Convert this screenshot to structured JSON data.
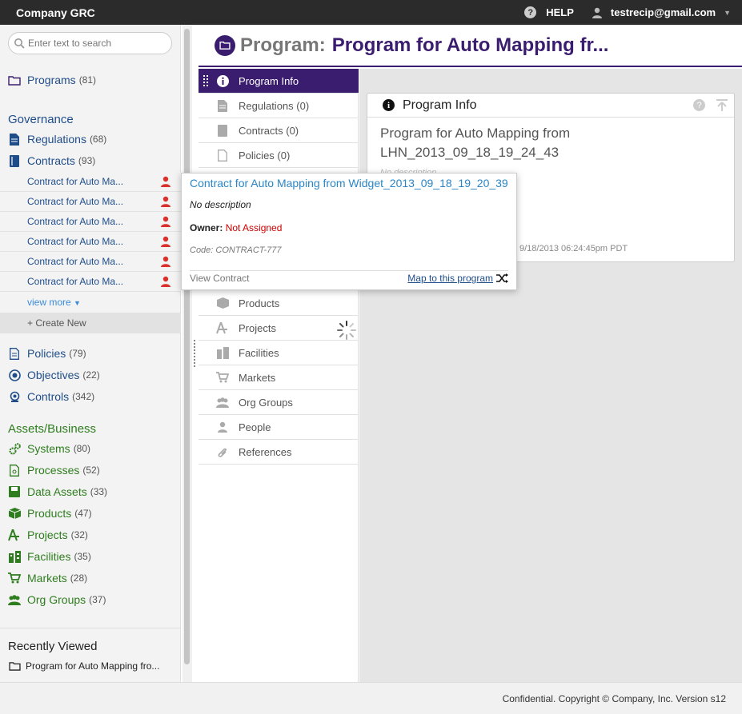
{
  "app": {
    "title": "Company GRC"
  },
  "topbar": {
    "help_label": "HELP",
    "user_email": "testrecip@gmail.com"
  },
  "search": {
    "placeholder": "Enter text to search"
  },
  "sidebar": {
    "programs": {
      "label": "Programs",
      "count": "(81)"
    },
    "governance_heading": "Governance",
    "regulations": {
      "label": "Regulations",
      "count": "(68)"
    },
    "contracts": {
      "label": "Contracts",
      "count": "(93)"
    },
    "contract_items": [
      "Contract for Auto Ma...",
      "Contract for Auto Ma...",
      "Contract for Auto Ma...",
      "Contract for Auto Ma...",
      "Contract for Auto Ma...",
      "Contract for Auto Ma..."
    ],
    "view_more": "view more",
    "create_new": "+ Create New",
    "policies": {
      "label": "Policies",
      "count": "(79)"
    },
    "objectives": {
      "label": "Objectives",
      "count": "(22)"
    },
    "controls": {
      "label": "Controls",
      "count": "(342)"
    },
    "assets_heading": "Assets/Business",
    "systems": {
      "label": "Systems",
      "count": "(80)"
    },
    "processes": {
      "label": "Processes",
      "count": "(52)"
    },
    "data_assets": {
      "label": "Data Assets",
      "count": "(33)"
    },
    "products": {
      "label": "Products",
      "count": "(47)"
    },
    "projects": {
      "label": "Projects",
      "count": "(32)"
    },
    "facilities": {
      "label": "Facilities",
      "count": "(35)"
    },
    "markets": {
      "label": "Markets",
      "count": "(28)"
    },
    "org_groups": {
      "label": "Org Groups",
      "count": "(37)"
    },
    "recent_heading": "Recently Viewed",
    "recent_item": "Program for Auto Mapping fro..."
  },
  "header": {
    "kind": "Program:",
    "title": "Program for Auto Mapping fr..."
  },
  "tabs": [
    {
      "label": "Program Info",
      "icon": "info-icon"
    },
    {
      "label": "Regulations (0)",
      "icon": "document-icon"
    },
    {
      "label": "Contracts (0)",
      "icon": "book-icon"
    },
    {
      "label": "Policies (0)",
      "icon": "page-icon"
    },
    {
      "label": "Products",
      "icon": "box-icon"
    },
    {
      "label": "Projects",
      "icon": "project-icon"
    },
    {
      "label": "Facilities",
      "icon": "building-icon"
    },
    {
      "label": "Markets",
      "icon": "cart-icon"
    },
    {
      "label": "Org Groups",
      "icon": "group-icon"
    },
    {
      "label": "People",
      "icon": "person-icon"
    },
    {
      "label": "References",
      "icon": "paperclip-icon"
    }
  ],
  "card": {
    "title": "Program Info",
    "name_line1": "Program for Auto Mapping from",
    "name_line2": "LHN_2013_09_18_19_24_43",
    "description": "No description",
    "date": "9/18/2013 06:24:45pm PDT"
  },
  "popover": {
    "title": "Contract for Auto Mapping from Widget_2013_09_18_19_20_39",
    "description": "No description",
    "owner_label": "Owner:",
    "owner_value": "Not Assigned",
    "code": "Code: CONTRACT-777",
    "view_link": "View Contract",
    "map_link": "Map to this program"
  },
  "footer": {
    "text": "Confidential. Copyright © Company, Inc. Version s12"
  },
  "colors": {
    "accent": "#3a1d6e",
    "governance": "#1f4d8a",
    "assets": "#2e7d1e",
    "link": "#2a86c7",
    "danger": "#cc0000"
  }
}
